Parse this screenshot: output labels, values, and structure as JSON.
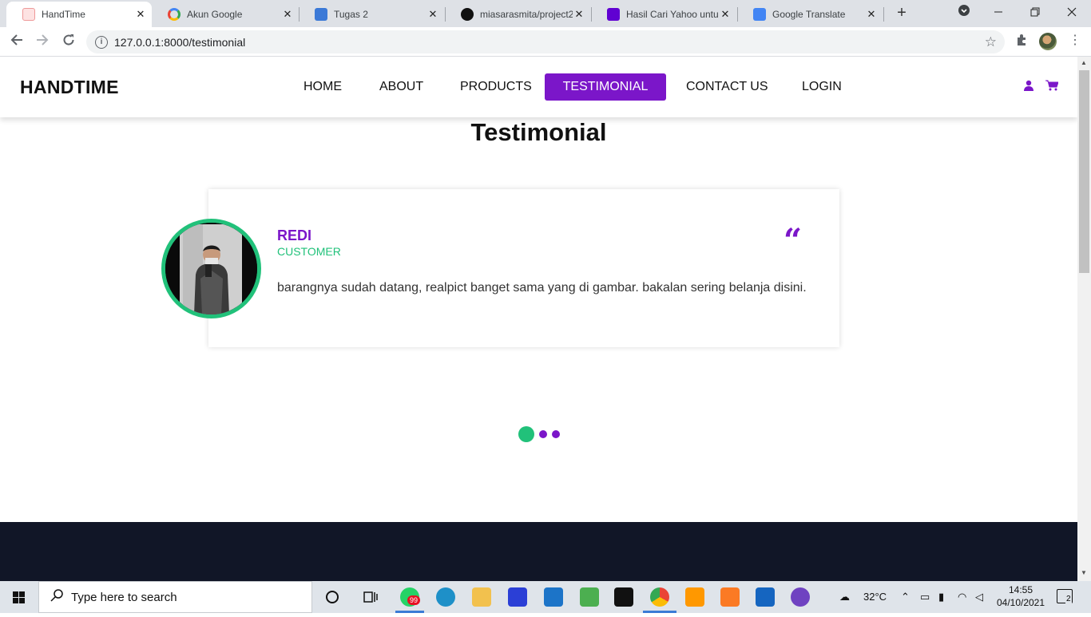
{
  "browser": {
    "tabs": [
      {
        "title": "HandTime",
        "active": true,
        "favicon": "handtime-favicon"
      },
      {
        "title": "Akun Google",
        "favicon": "google-icon"
      },
      {
        "title": "Tugas 2",
        "favicon": "classroom-icon"
      },
      {
        "title": "miasarasmita/project2",
        "favicon": "github-icon"
      },
      {
        "title": "Hasil Cari Yahoo untuk",
        "favicon": "yahoo-icon"
      },
      {
        "title": "Google Translate",
        "favicon": "translate-icon"
      }
    ],
    "close_glyph": "✕",
    "new_tab_glyph": "+",
    "url": "127.0.0.1:8000/testimonial"
  },
  "site": {
    "logo": "HANDTIME",
    "nav": [
      {
        "label": "HOME"
      },
      {
        "label": "ABOUT"
      },
      {
        "label": "PRODUCTS"
      },
      {
        "label": "TESTIMONIAL",
        "active": true
      },
      {
        "label": "CONTACT US"
      },
      {
        "label": "LOGIN"
      }
    ],
    "icons": [
      "user-icon",
      "cart-icon"
    ],
    "accent": "#7b16c9",
    "green": "#21c17a"
  },
  "testimonial": {
    "heading": "Testimonial",
    "name": "REDI",
    "role": "CUSTOMER",
    "quote_glyph": "“",
    "text": "barangnya sudah datang, realpict banget sama yang di gambar. bakalan sering belanja disini.",
    "slides_total": 3,
    "slide_active": 1
  },
  "taskbar": {
    "search_placeholder": "Type here to search",
    "badge": "99",
    "weather": "32°C",
    "time": "14:55",
    "date": "04/10/2021",
    "notifications": "2"
  }
}
